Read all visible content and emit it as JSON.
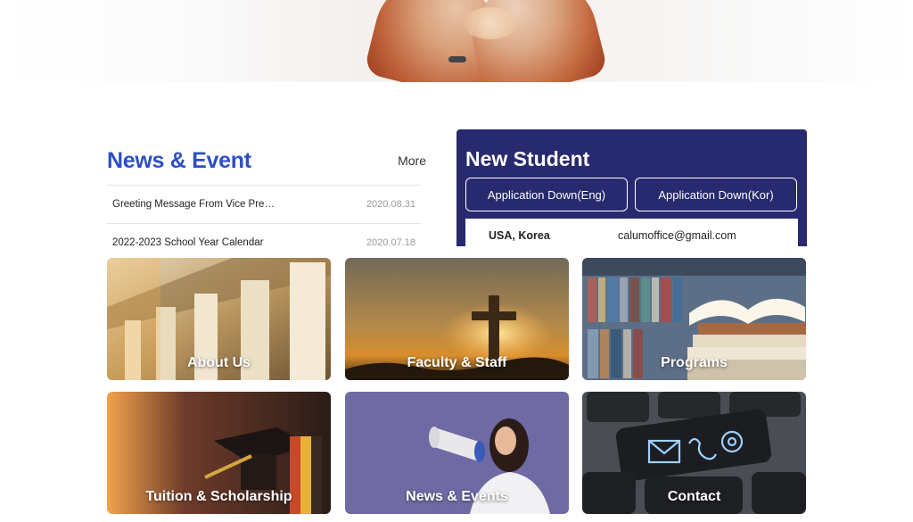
{
  "news": {
    "title": "News & Event",
    "more_label": "More",
    "items": [
      {
        "title": "Greeting Message From Vice Pre…",
        "date": "2020.08.31"
      },
      {
        "title": "2022-2023 School Year Calendar",
        "date": "2020.07.18"
      }
    ]
  },
  "new_student": {
    "title": "New Student",
    "buttons": [
      {
        "label": "Application Down(Eng)"
      },
      {
        "label": "Application Down(Kor)"
      }
    ],
    "location": "USA, Korea",
    "email": "calumoffice@gmail.com",
    "background_color": "#272a6e"
  },
  "tiles": [
    {
      "label": "About Us",
      "image": "columns-building"
    },
    {
      "label": "Faculty & Staff",
      "image": "cross-sunset"
    },
    {
      "label": "Programs",
      "image": "books"
    },
    {
      "label": "Tuition & Scholarship",
      "image": "graduation-cap"
    },
    {
      "label": "News & Events",
      "image": "megaphone-woman"
    },
    {
      "label": "Contact",
      "image": "keyboard-contact-keys"
    }
  ],
  "colors": {
    "accent_blue": "#2d4fc4",
    "panel_navy": "#272a6e"
  }
}
